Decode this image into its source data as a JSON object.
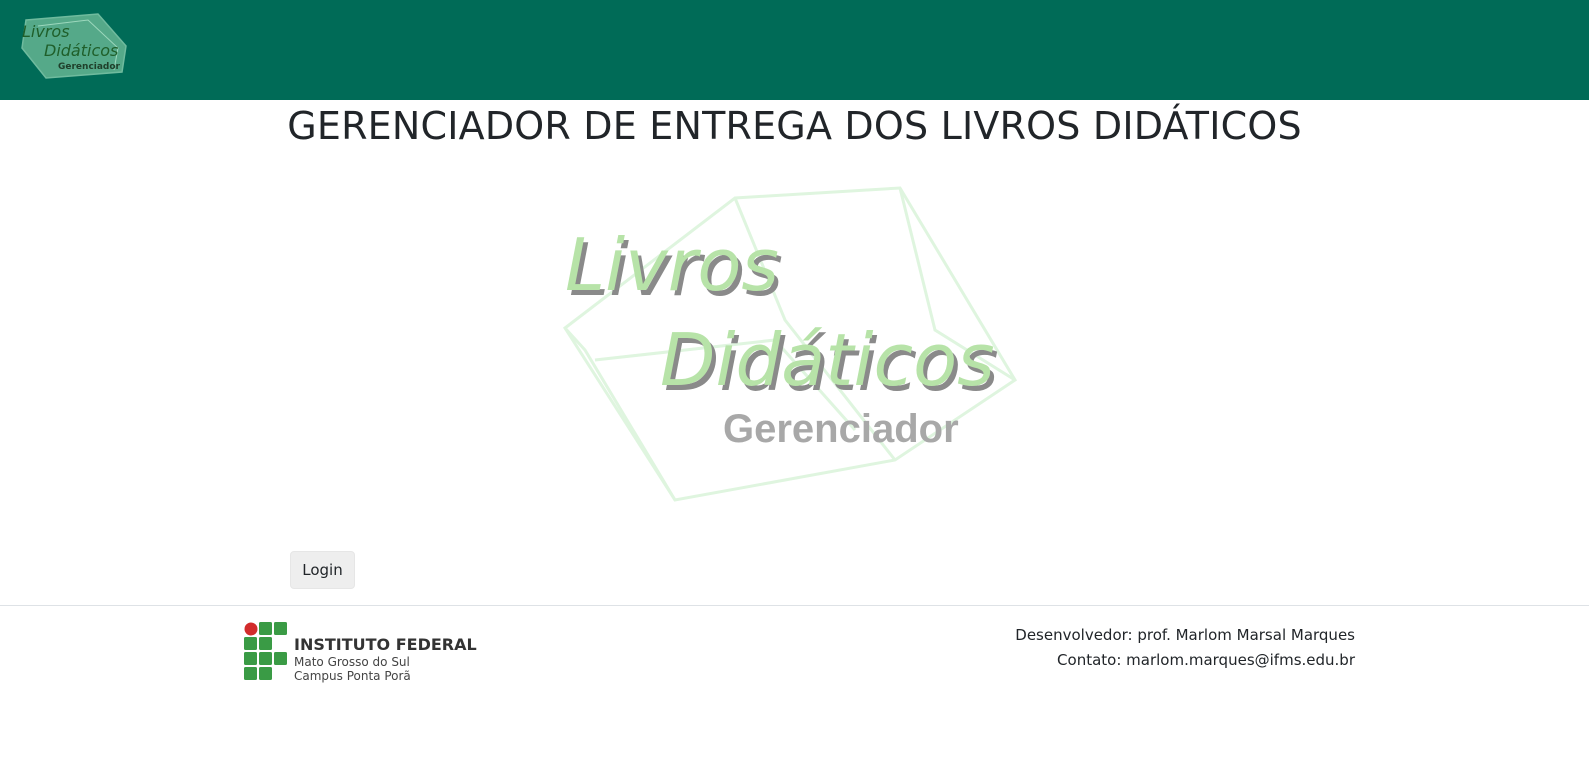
{
  "header": {
    "logo_text_line1": "Livros",
    "logo_text_line2": "Didáticos",
    "logo_text_line3": "Gerenciador"
  },
  "main": {
    "title": "GERENCIADOR DE ENTREGA DOS LIVROS DIDÁTICOS",
    "hero_line1": "Livros",
    "hero_line2": "Didáticos",
    "hero_line3": "Gerenciador",
    "login_label": "Login"
  },
  "footer": {
    "institution_name": "INSTITUTO FEDERAL",
    "institution_state": "Mato Grosso do Sul",
    "institution_campus": "Campus Ponta Porã",
    "developer": "Desenvolvedor: prof. Marlom Marsal Marques",
    "contact": "Contato: marlom.marques@ifms.edu.br"
  },
  "colors": {
    "header_bg": "#006b57",
    "if_green": "#3a9b45",
    "if_red": "#d22c2c"
  }
}
